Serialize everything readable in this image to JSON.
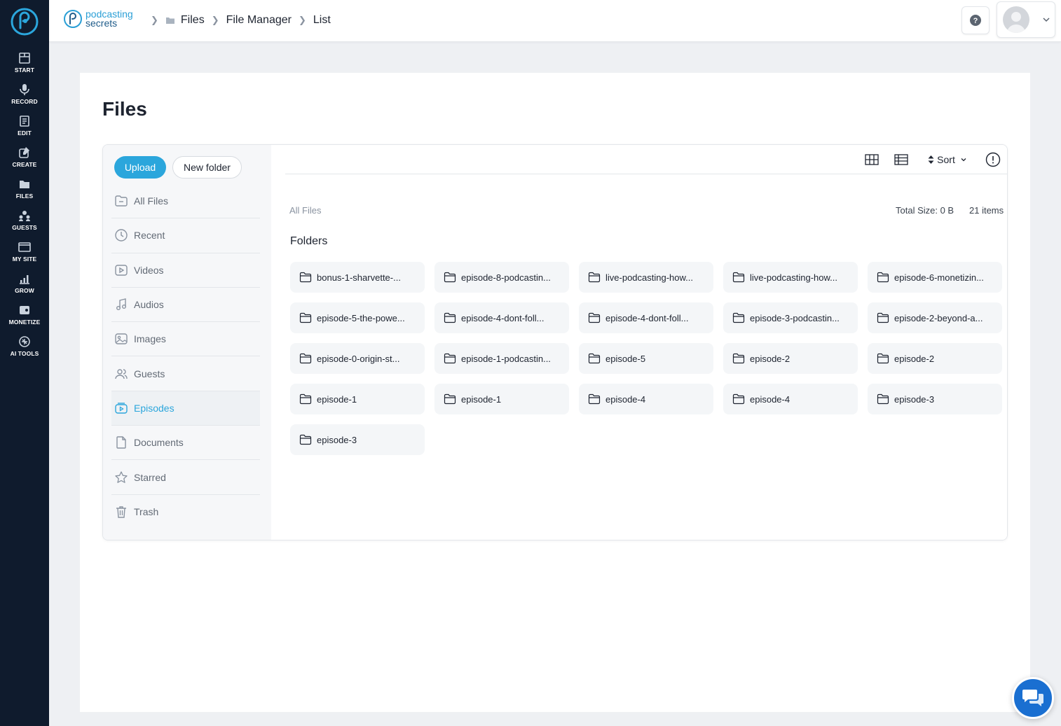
{
  "app": {
    "brand_line1": "podcasting",
    "brand_line2": "secrets"
  },
  "rail": {
    "items": [
      {
        "label": "START",
        "icon": "start-icon"
      },
      {
        "label": "RECORD",
        "icon": "microphone-icon"
      },
      {
        "label": "EDIT",
        "icon": "edit-icon"
      },
      {
        "label": "CREATE",
        "icon": "create-icon"
      },
      {
        "label": "FILES",
        "icon": "files-icon"
      },
      {
        "label": "GUESTS",
        "icon": "guests-icon"
      },
      {
        "label": "MY SITE",
        "icon": "site-icon"
      },
      {
        "label": "GROW",
        "icon": "grow-icon"
      },
      {
        "label": "MONETIZE",
        "icon": "monetize-icon"
      },
      {
        "label": "AI TOOLS",
        "icon": "ai-tools-icon"
      }
    ]
  },
  "breadcrumb": {
    "items": [
      "Files",
      "File Manager",
      "List"
    ]
  },
  "page": {
    "title": "Files"
  },
  "sidebar": {
    "upload_label": "Upload",
    "new_folder_label": "New folder",
    "items": [
      {
        "label": "All Files",
        "icon": "all-files-icon",
        "active": false
      },
      {
        "label": "Recent",
        "icon": "clock-icon",
        "active": false
      },
      {
        "label": "Videos",
        "icon": "video-icon",
        "active": false
      },
      {
        "label": "Audios",
        "icon": "music-note-icon",
        "active": false
      },
      {
        "label": "Images",
        "icon": "image-icon",
        "active": false
      },
      {
        "label": "Guests",
        "icon": "users-icon",
        "active": false
      },
      {
        "label": "Episodes",
        "icon": "episodes-icon",
        "active": true
      },
      {
        "label": "Documents",
        "icon": "document-icon",
        "active": false
      },
      {
        "label": "Starred",
        "icon": "star-icon",
        "active": false
      },
      {
        "label": "Trash",
        "icon": "trash-icon",
        "active": false
      }
    ]
  },
  "toolbar": {
    "sort_label": "Sort"
  },
  "main": {
    "path_label": "All Files",
    "total_size": "Total Size: 0 B",
    "items_count": "21 items",
    "folders_heading": "Folders",
    "folders": [
      "bonus-1-sharvette-...",
      "episode-8-podcastin...",
      "live-podcasting-how...",
      "live-podcasting-how...",
      "episode-6-monetizin...",
      "episode-5-the-powe...",
      "episode-4-dont-foll...",
      "episode-4-dont-foll...",
      "episode-3-podcastin...",
      "episode-2-beyond-a...",
      "episode-0-origin-st...",
      "episode-1-podcastin...",
      "episode-5",
      "episode-2",
      "episode-2",
      "episode-1",
      "episode-1",
      "episode-4",
      "episode-4",
      "episode-3",
      "episode-3"
    ]
  },
  "colors": {
    "rail_bg": "#0f1b2d",
    "accent": "#2ba6dc",
    "chat": "#1a6fd1"
  }
}
